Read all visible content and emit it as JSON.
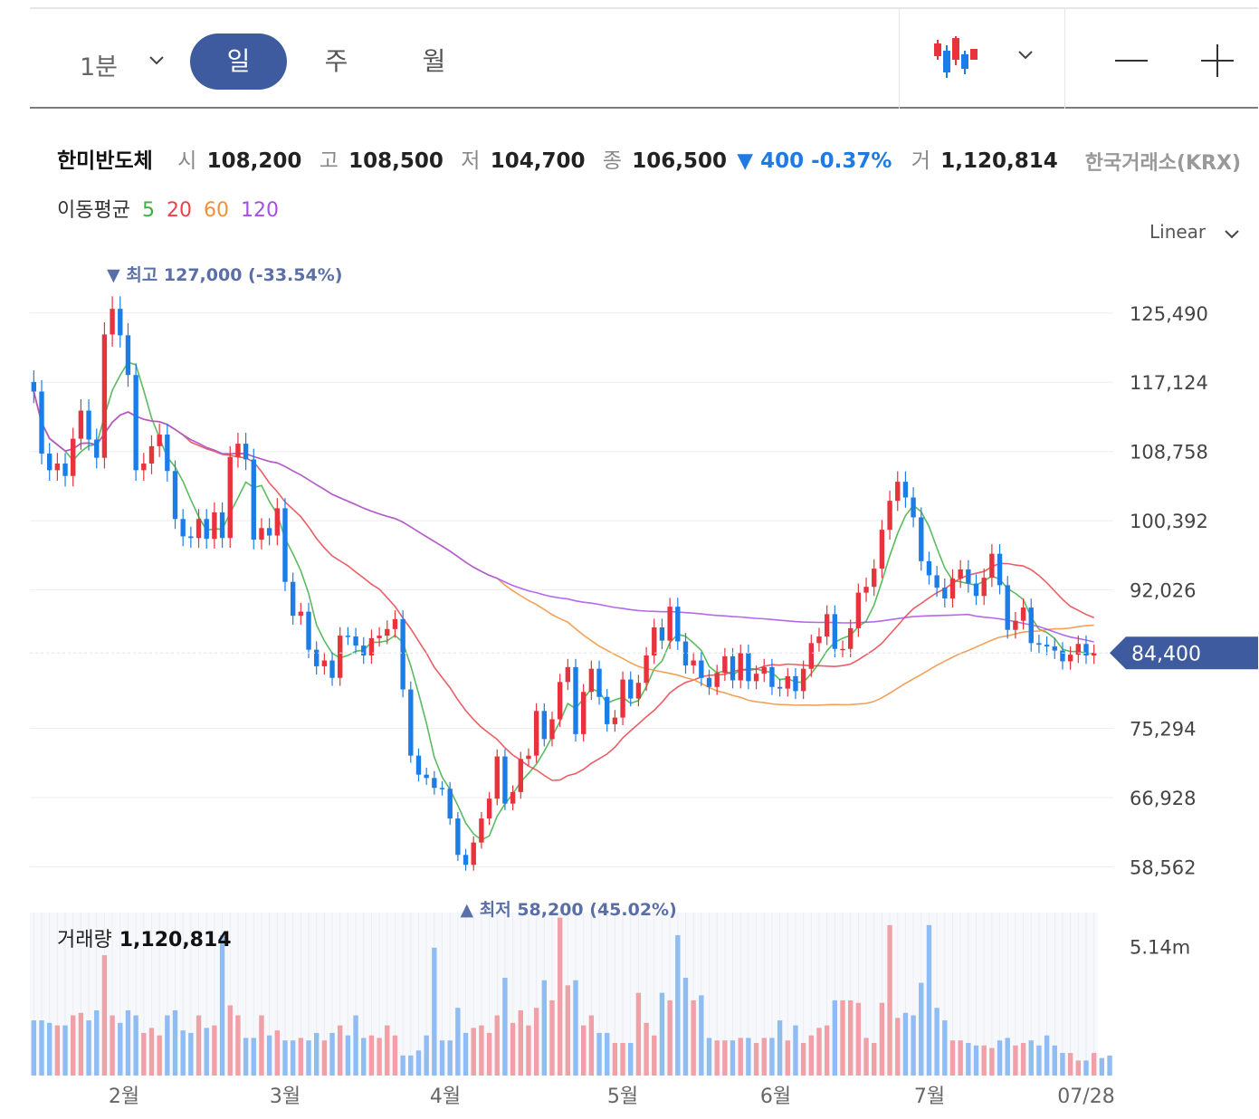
{
  "toolbar": {
    "interval": "1분",
    "periods": [
      "일",
      "주",
      "월"
    ],
    "active_period": "일",
    "chart_type_icon": "candlestick-icon",
    "zoom_out_icon": "minus-icon",
    "zoom_in_icon": "plus-icon"
  },
  "stock": {
    "name": "한미반도체",
    "open_label": "시",
    "open": "108,200",
    "high_label": "고",
    "high": "108,500",
    "low_label": "저",
    "low": "104,700",
    "close_label": "종",
    "close": "106,500",
    "change": "▼ 400 -0.37%",
    "volume_label": "거",
    "volume": "1,120,814",
    "exchange": "한국거래소(KRX)"
  },
  "ma_legend": {
    "label": "이동평균",
    "periods": [
      "5",
      "20",
      "60",
      "120"
    ],
    "colors": [
      "#3cb043",
      "#e8424a",
      "#f0913a",
      "#a44fe8"
    ]
  },
  "scale": "Linear",
  "volume_panel": {
    "label": "거래량",
    "value": "1,120,814"
  },
  "colors": {
    "up": "#e8323c",
    "down": "#1b7de8",
    "up_volume": "#f0a0a6",
    "down_volume": "#8fbcf2",
    "accent": "#3d5b9e",
    "marker": "#5a6fa8"
  },
  "chart_data": {
    "type": "candlestick",
    "y_ticks": [
      "125,490",
      "117,124",
      "108,758",
      "100,392",
      "92,026",
      "75,294",
      "66,928",
      "58,562"
    ],
    "y_tick_values": [
      125490,
      117124,
      108758,
      100392,
      92026,
      75294,
      66928,
      58562
    ],
    "ylim": [
      55000,
      130500
    ],
    "current_price": 84400,
    "current_price_label": "84,400",
    "high_marker": {
      "label": "▼ 최고 127,000 (-33.54%)",
      "value": 127000
    },
    "low_marker": {
      "label": "▲ 최저 58,200 (45.02%)",
      "value": 58200
    },
    "x_labels": [
      "2월",
      "3월",
      "4월",
      "5월",
      "6월",
      "7월",
      "07/28"
    ],
    "volume_ticks": [
      "5.14m"
    ],
    "volume_tick_values": [
      5140000
    ],
    "volume_max": 6500000,
    "ohlc_close": [
      116000,
      108500,
      106500,
      107300,
      105800,
      110300,
      113700,
      110200,
      108000,
      122900,
      126000,
      122800,
      118000,
      106500,
      107300,
      109400,
      110800,
      106400,
      100600,
      98500,
      98300,
      100600,
      98200,
      101400,
      98300,
      108100,
      109700,
      107800,
      98100,
      99500,
      98600,
      101900,
      93000,
      88900,
      89400,
      84800,
      82800,
      83500,
      81400,
      86500,
      86400,
      85300,
      84100,
      86200,
      86500,
      87300,
      88500,
      80000,
      72000,
      69700,
      69300,
      68100,
      68000,
      64400,
      60000,
      58800,
      61500,
      64400,
      66800,
      71900,
      66200,
      67600,
      71600,
      72000,
      77400,
      74000,
      76400,
      80900,
      82700,
      74600,
      79700,
      82500,
      79100,
      75800,
      76600,
      81200,
      78900,
      80800,
      84100,
      87500,
      85900,
      90000,
      85800,
      82900,
      83500,
      81400,
      80300,
      82000,
      84000,
      81100,
      84400,
      81000,
      81900,
      82700,
      80300,
      80100,
      81600,
      79800,
      82500,
      85600,
      86400,
      89100,
      84900,
      84900,
      87400,
      91700,
      92400,
      94600,
      99300,
      102800,
      105100,
      103200,
      100800,
      95500,
      93800,
      92300,
      91000,
      93400,
      94500,
      92800,
      91300,
      93500,
      96400,
      92600,
      87200,
      88300,
      89900,
      85600,
      85400,
      85200,
      84700,
      83400,
      84200,
      85500,
      84100,
      84400
    ],
    "volume": [
      2200000,
      2200000,
      2100000,
      2000000,
      2000000,
      2400000,
      2500000,
      2200000,
      2600000,
      4800000,
      2400000,
      2100000,
      2600000,
      2400000,
      1700000,
      1900000,
      1600000,
      2400000,
      2600000,
      1800000,
      1700000,
      2400000,
      1900000,
      2000000,
      5600000,
      2800000,
      2400000,
      1500000,
      1500000,
      2400000,
      1600000,
      1800000,
      1400000,
      1400000,
      1500000,
      1400000,
      1700000,
      1400000,
      1700000,
      2000000,
      1600000,
      2400000,
      1500000,
      1600000,
      1500000,
      2000000,
      1600000,
      800000,
      800000,
      1000000,
      1600000,
      5100000,
      1400000,
      1400000,
      2700000,
      1700000,
      1900000,
      2000000,
      1700000,
      2400000,
      3900000,
      2100000,
      2600000,
      2000000,
      2700000,
      3800000,
      3000000,
      6300000,
      3600000,
      3800000,
      2000000,
      2400000,
      1700000,
      1700000,
      1300000,
      1300000,
      1300000,
      3300000,
      2100000,
      1600000,
      3300000,
      3000000,
      5600000,
      3900000,
      3000000,
      3200000,
      1500000,
      1400000,
      1400000,
      1400000,
      1500000,
      1500000,
      1300000,
      1500000,
      1500000,
      2200000,
      1400000,
      2000000,
      1300000,
      1600000,
      1900000,
      2000000,
      3000000,
      3000000,
      3000000,
      2900000,
      1500000,
      1300000,
      2900000,
      6000000,
      2300000,
      2500000,
      2400000,
      3700000,
      6000000,
      2700000,
      2200000,
      1400000,
      1400000,
      1300000,
      1200000,
      1200000,
      1100000,
      1400000,
      1500000,
      1200000,
      1300000,
      1400000,
      1200000,
      1600000,
      1200000,
      900000,
      900000,
      600000,
      600000,
      900000,
      700000,
      800000
    ]
  }
}
